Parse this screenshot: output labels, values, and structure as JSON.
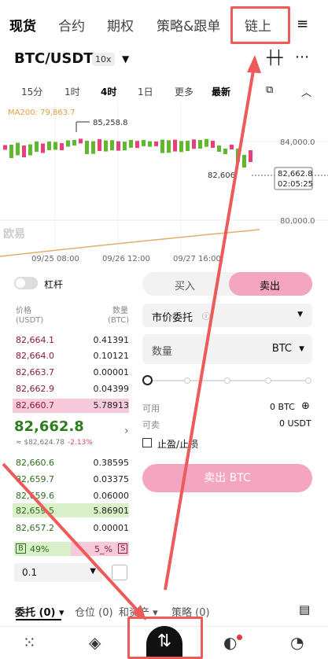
{
  "top_tabs": [
    "现货",
    "合约",
    "期权",
    "策略&跟单",
    "链上"
  ],
  "pair": {
    "symbol": "BTC/USDT",
    "leverage": "10x"
  },
  "intervals": [
    "15分",
    "1时",
    "4时",
    "1日",
    "更多",
    "最新"
  ],
  "chart": {
    "ma_label": "MA200: 79,863.7",
    "high_label": "85,258.8",
    "low_label": "82,606",
    "price_ticks": [
      "84,000.0",
      "82,000.0",
      "80,000.0"
    ],
    "last_price": "82,662.8",
    "countdown": "02:05:25",
    "dates": [
      "09/25 08:00",
      "09/26 12:00",
      "09/27 16:00"
    ],
    "watermark": "欧易"
  },
  "colors": {
    "up": "#5fb82e",
    "down": "#e8407a",
    "ma": "#e0b06a",
    "highlight": "#ee5a5a"
  },
  "leverage_toggle": "杠杆",
  "book": {
    "price_header": "价格",
    "price_unit": "(USDT)",
    "qty_header": "数量",
    "qty_unit": "(BTC)",
    "asks": [
      {
        "p": "82,664.1",
        "q": "0.41391"
      },
      {
        "p": "82,664.0",
        "q": "0.10121"
      },
      {
        "p": "82,663.7",
        "q": "0.00001"
      },
      {
        "p": "82,662.9",
        "q": "0.04399"
      },
      {
        "p": "82,660.7",
        "q": "5.78913"
      }
    ],
    "mid_price": "82,662.8",
    "mid_sub": "≈ $82,624.78",
    "mid_change": "-2.13%",
    "bids": [
      {
        "p": "82,660.6",
        "q": "0.38595"
      },
      {
        "p": "82,659.7",
        "q": "0.03375"
      },
      {
        "p": "82,659.6",
        "q": "0.06000"
      },
      {
        "p": "82,659.5",
        "q": "5.86901"
      },
      {
        "p": "82,657.2",
        "q": "0.00001"
      }
    ],
    "buy_label": "B",
    "buy_pct": "49%",
    "sell_pct": "5_%",
    "sell_label": "S",
    "depth_step": "0.1"
  },
  "trade": {
    "buy_tab": "买入",
    "sell_tab": "卖出",
    "order_type": "市价委托",
    "qty_label": "数量",
    "qty_unit": "BTC",
    "available_label": "可用",
    "available_value": "0 BTC",
    "sellable_label": "可卖",
    "sellable_value": "0 USDT",
    "tpsl_label": "止盈/止损",
    "submit": "卖出 BTC"
  },
  "bottom_tabs": [
    {
      "label": "委托",
      "count": "(0)"
    },
    {
      "label": "仓位",
      "count": "(0)"
    },
    {
      "label": "和资产",
      "count": ""
    },
    {
      "label": "策略",
      "count": "(0)"
    }
  ]
}
